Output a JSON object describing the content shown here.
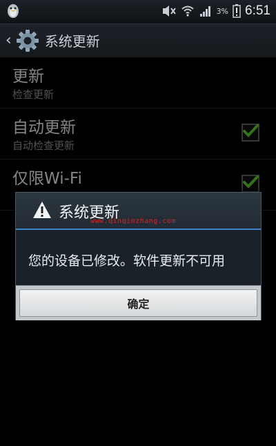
{
  "status_bar": {
    "battery_percent": "3%",
    "time": "6:51"
  },
  "action_bar": {
    "title": "系统更新"
  },
  "settings": [
    {
      "title": "更新",
      "subtitle": "检查更新",
      "has_checkbox": false
    },
    {
      "title": "自动更新",
      "subtitle": "自动检查更新",
      "checked": true
    },
    {
      "title": "仅限Wi-Fi",
      "subtitle": "",
      "checked": true
    }
  ],
  "dialog": {
    "title": "系统更新",
    "watermark": "www.qinqinzhang.com",
    "message": "您的设备已修改。软件更新不可用",
    "ok_label": "确定"
  },
  "colors": {
    "accent_blue": "#3d86c6",
    "check_green": "#5fd12a",
    "warning_red": "#e02020"
  }
}
